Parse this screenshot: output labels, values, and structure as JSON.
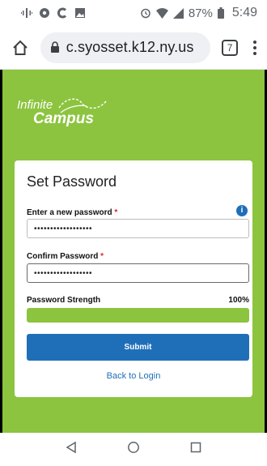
{
  "status_bar": {
    "left_icons": [
      "signal-vibrate-icon",
      "cast-icon",
      "c-app-icon",
      "gallery-icon"
    ],
    "right_icons": [
      "alarm-icon",
      "wifi-icon",
      "cell-signal-icon"
    ],
    "battery": "87%",
    "time": "5:49"
  },
  "browser": {
    "url": "c.syosset.k12.ny.us",
    "tab_count": "7"
  },
  "logo": {
    "line1": "Infinite",
    "line2": "Campus"
  },
  "form": {
    "title": "Set Password",
    "new_password": {
      "label": "Enter a new password",
      "required": "*",
      "value": "••••••••••••••••••"
    },
    "confirm_password": {
      "label": "Confirm Password",
      "required": "*",
      "value": "••••••••••••••••••"
    },
    "strength": {
      "label": "Password Strength",
      "value": "100%",
      "fraction": 1.0
    },
    "submit_label": "Submit",
    "back_link": "Back to Login"
  },
  "colors": {
    "brand_green": "#8cc43f",
    "primary_blue": "#1f6fb8",
    "required_red": "#d9261c"
  }
}
